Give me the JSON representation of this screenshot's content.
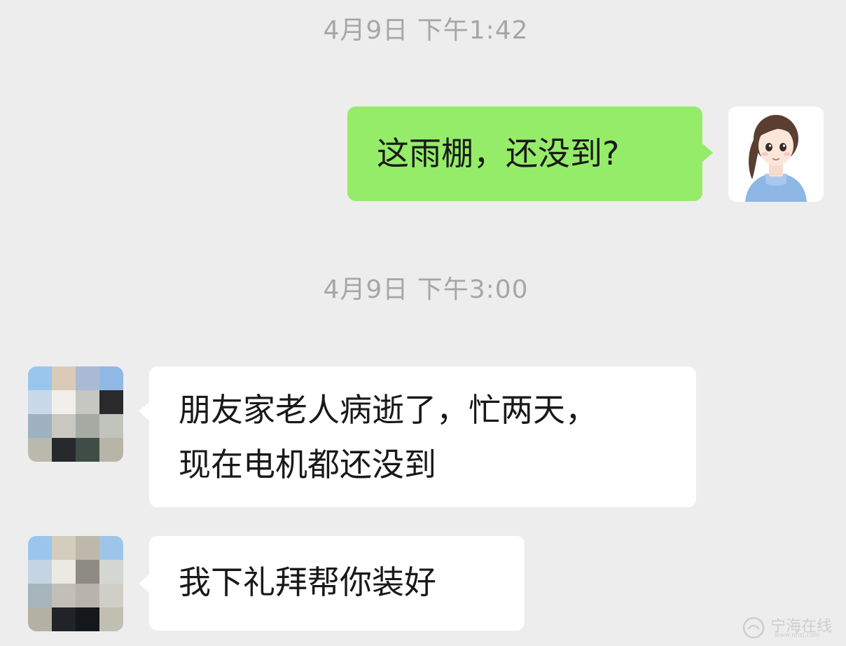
{
  "chat": {
    "timestamps": [
      "4月9日 下午1:42",
      "4月9日 下午3:00"
    ],
    "messages": [
      {
        "from": "self",
        "text": "这雨棚，还没到?"
      },
      {
        "from": "friend",
        "lines": [
          "朋友家老人病逝了，忙两天，",
          "现在电机都还没到"
        ]
      },
      {
        "from": "friend",
        "text": "我下礼拜帮你装好"
      }
    ]
  },
  "watermark": {
    "text": "宁海在线",
    "sub": "www.nhzj.com"
  },
  "colors": {
    "background": "#ededed",
    "outgoing_bubble": "#95ec69",
    "incoming_bubble": "#ffffff",
    "timestamp_text": "#a6a6a6",
    "message_text": "#191919"
  },
  "icons": {
    "self_avatar": "cartoon-girl-avatar",
    "friend_avatar": "pixelated-avatar"
  }
}
